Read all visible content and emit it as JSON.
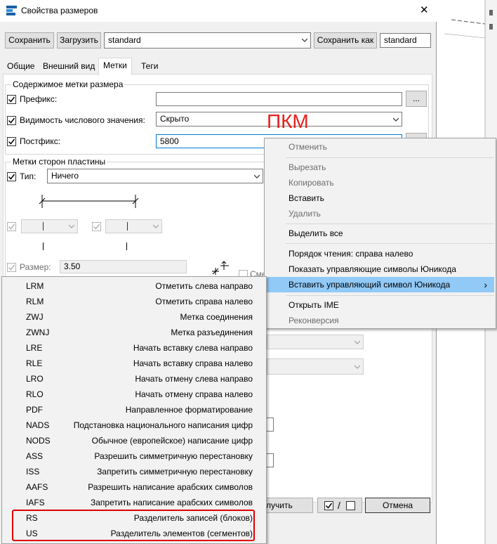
{
  "window": {
    "title": "Свойства размеров",
    "close_glyph": "✕"
  },
  "toolbar": {
    "save_label": "Сохранить",
    "load_label": "Загрузить",
    "preset_value": "standard",
    "save_as_label": "Сохранить как",
    "save_as_value": "standard"
  },
  "tabs": [
    {
      "label": "Общие"
    },
    {
      "label": "Внешний вид"
    },
    {
      "label": "Метки"
    },
    {
      "label": "Теги"
    }
  ],
  "content_group": {
    "title": "Содержимое метки размера",
    "prefix_label": "Префикс:",
    "prefix_value": "",
    "visibility_label": "Видимость числового значения:",
    "visibility_value": "Скрыто",
    "postfix_label": "Постфикс:",
    "postfix_value": "5800",
    "browse_label": "..."
  },
  "annotation": {
    "text": "ПКМ",
    "color": "#e8201c"
  },
  "plate_group": {
    "title": "Метки сторон пластины",
    "type_label": "Тип:",
    "type_value": "Ничего",
    "size_label": "Размер:",
    "size_value": "3.50",
    "partial_label": "Сме"
  },
  "context_menu": {
    "items": [
      {
        "label": "Отменить",
        "enabled": false
      },
      {
        "label": "Вырезать",
        "enabled": false
      },
      {
        "label": "Копировать",
        "enabled": false
      },
      {
        "label": "Вставить",
        "enabled": true
      },
      {
        "label": "Удалить",
        "enabled": false
      },
      {
        "label": "Выделить все",
        "enabled": true
      },
      {
        "label": "Порядок чтения: справа налево",
        "enabled": true
      },
      {
        "label": "Показать управляющие символы Юникода",
        "enabled": true
      },
      {
        "label": "Вставить управляющий символ Юникода",
        "enabled": true,
        "submenu_arrow": "›"
      },
      {
        "label": "Открыть IME",
        "enabled": true
      },
      {
        "label": "Реконверсия",
        "enabled": false
      }
    ]
  },
  "submenu": {
    "items": [
      {
        "code": "LRM",
        "desc": "Отметить слева направо"
      },
      {
        "code": "RLM",
        "desc": "Отметить справа налево"
      },
      {
        "code": "ZWJ",
        "desc": "Метка соединения"
      },
      {
        "code": "ZWNJ",
        "desc": "Метка разъединения"
      },
      {
        "code": "LRE",
        "desc": "Начать вставку слева направо"
      },
      {
        "code": "RLE",
        "desc": "Начать вставку справа налево"
      },
      {
        "code": "LRO",
        "desc": "Начать отмену слева направо"
      },
      {
        "code": "RLO",
        "desc": "Начать отмену справа налево"
      },
      {
        "code": "PDF",
        "desc": "Направленное форматирование"
      },
      {
        "code": "NADS",
        "desc": "Подстановка национального написания цифр"
      },
      {
        "code": "NODS",
        "desc": "Обычное (европейское) написание цифр"
      },
      {
        "code": "ASS",
        "desc": "Разрешить симметричную перестановку"
      },
      {
        "code": "ISS",
        "desc": "Запретить симметричную перестановку"
      },
      {
        "code": "AAFS",
        "desc": "Разрешить написание арабских символов"
      },
      {
        "code": "IAFS",
        "desc": "Запретить написание арабских символов"
      },
      {
        "code": "RS",
        "desc": "Разделитель записей (блоков)"
      },
      {
        "code": "US",
        "desc": "Разделитель элементов (сегментов)"
      }
    ],
    "highlight_color": "#e00000"
  },
  "bottom": {
    "apply_label": "лучить",
    "check_toggle_label": "/",
    "cancel_label": "Отмена"
  }
}
